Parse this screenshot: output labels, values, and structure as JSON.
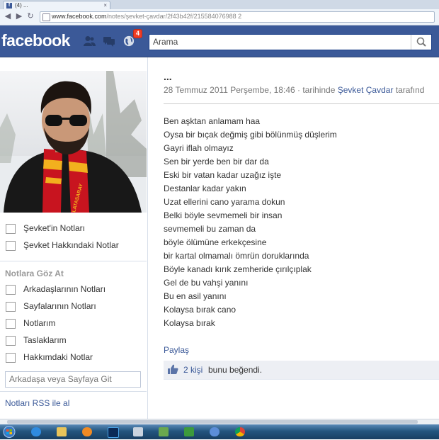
{
  "browser": {
    "tab_title": "(4) ...",
    "favicon_letter": "f",
    "url_domain": "www.facebook.com",
    "url_path": "/notes/şevket-çavdar/2f43b42f/215584076988 2"
  },
  "header": {
    "logo": "facebook",
    "notification_count": "4",
    "search_placeholder": "Arama"
  },
  "sidebar": {
    "profile_links": [
      "Şevket'in Notları",
      "Şevket Hakkındaki Notlar"
    ],
    "section_title": "Notlara Göz At",
    "browse_links": [
      "Arkadaşlarının Notları",
      "Sayfalarının Notları",
      "Notlarım",
      "Taslaklarım",
      "Hakkımdaki Notlar"
    ],
    "goto_placeholder": "Arkadaşa veya Sayfaya Git",
    "rss_link": "Notları RSS ile al",
    "scarf_text": "GALATASARAY"
  },
  "note": {
    "title": "...",
    "date": "28 Temmuz 2011 Perşembe, 18:46",
    "date_suffix": "· tarihinde",
    "author": "Şevket Çavdar",
    "author_suffix": "tarafınd",
    "lines": [
      "Ben aşktan anlamam haa",
      "Oysa bir bıçak değmiş gibi bölünmüş düşlerim",
      "Gayri iflah olmayız",
      "Sen bir yerde ben bir dar da",
      "Eski bir vatan kadar uzağız işte",
      "Destanlar kadar yakın",
      "Uzat ellerini cano yarama dokun",
      "Belki böyle sevmemeli bir insan",
      "sevmemeli bu zaman da",
      "böyle ölümüne erkekçesine",
      "bir kartal olmamalı ömrün doruklarında",
      "Böyle kanadı kırık zemheride çırılçıplak",
      "Gel de bu vahşi yanını",
      "Bu en asil yanını",
      "Kolaysa bırak cano",
      "Kolaysa bırak"
    ],
    "share_label": "Paylaş",
    "likes_count": "2 kişi",
    "likes_suffix": "bunu beğendi."
  },
  "colors": {
    "fb_blue": "#3b5998",
    "badge_red": "#f03d25"
  },
  "taskbar": {
    "icons": [
      "windows-start-icon",
      "ie-icon",
      "folder-icon",
      "media-player-icon",
      "photoshop-icon",
      "window-icon",
      "app-icon",
      "network-icon",
      "itunes-icon",
      "chrome-icon"
    ]
  }
}
